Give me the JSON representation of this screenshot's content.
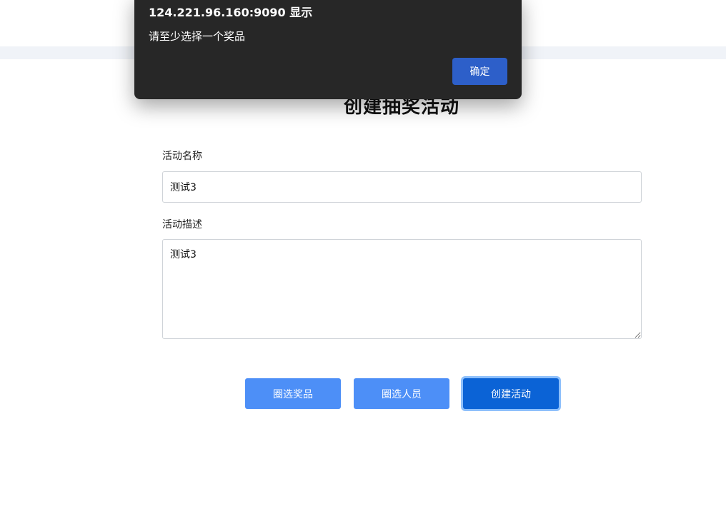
{
  "page": {
    "title": "创建抽奖活动"
  },
  "form": {
    "name_label": "活动名称",
    "name_value": "测试3",
    "description_label": "活动描述",
    "description_value": "测试3"
  },
  "actions": {
    "select_prizes_label": "圈选奖品",
    "select_people_label": "圈选人员",
    "create_label": "创建活动"
  },
  "alert_dialog": {
    "title": "124.221.96.160:9090 显示",
    "message": "请至少选择一个奖品",
    "ok_label": "确定"
  },
  "colors": {
    "button_blue": "#4d8ff7",
    "primary_blue": "#0b63d6",
    "dialog_bg": "#272727",
    "dialog_button": "#2d5fc9"
  }
}
